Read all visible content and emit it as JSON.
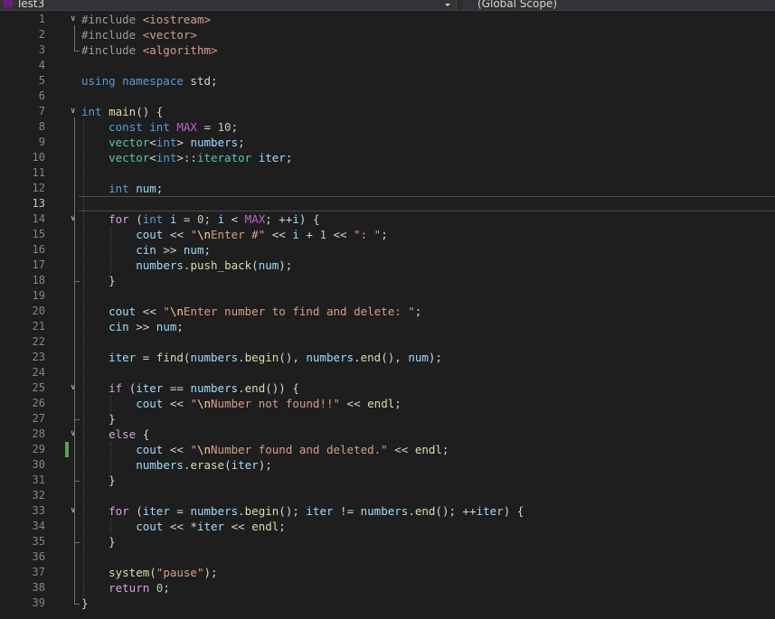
{
  "topbar": {
    "file_dropdown_label": "Test3",
    "scope_dropdown_label": "(Global Scope)"
  },
  "colors": {
    "keyword": "#569cd6",
    "control": "#d8a0df",
    "type": "#4ec9b0",
    "string": "#d69d85",
    "escape": "#ffd68f",
    "number": "#b5cea8",
    "variable": "#9cdcfe",
    "function": "#dcdcaa",
    "preprocessor": "#9b9b9b",
    "text": "#d4d4d4",
    "macro": "#bd63c5"
  },
  "editor": {
    "current_line": 13,
    "changed_lines": [
      29
    ],
    "fold_lines": [
      1,
      7,
      14,
      25,
      28,
      33
    ],
    "lines": [
      {
        "n": "1",
        "tokens": [
          [
            "#include ",
            "preprocessor"
          ],
          [
            "<iostream>",
            "string"
          ]
        ]
      },
      {
        "n": "2",
        "tokens": [
          [
            "#include ",
            "preprocessor"
          ],
          [
            "<vector>",
            "string"
          ]
        ]
      },
      {
        "n": "3",
        "tokens": [
          [
            "#include ",
            "preprocessor"
          ],
          [
            "<algorithm>",
            "string"
          ]
        ]
      },
      {
        "n": "4",
        "tokens": []
      },
      {
        "n": "5",
        "tokens": [
          [
            "using ",
            "keyword"
          ],
          [
            "namespace ",
            "keyword"
          ],
          [
            "std;",
            "text"
          ]
        ]
      },
      {
        "n": "6",
        "tokens": []
      },
      {
        "n": "7",
        "tokens": [
          [
            "int ",
            "keyword"
          ],
          [
            "main",
            "function"
          ],
          [
            "() {",
            "text"
          ]
        ]
      },
      {
        "n": "8",
        "tokens": [
          [
            "    ",
            "text"
          ],
          [
            "const ",
            "keyword"
          ],
          [
            "int ",
            "keyword"
          ],
          [
            "MAX",
            "macro"
          ],
          [
            " = ",
            "text"
          ],
          [
            "10",
            "number"
          ],
          [
            ";",
            "text"
          ]
        ]
      },
      {
        "n": "9",
        "tokens": [
          [
            "    ",
            "text"
          ],
          [
            "vector",
            "type"
          ],
          [
            "<",
            "text"
          ],
          [
            "int",
            "keyword"
          ],
          [
            "> ",
            "text"
          ],
          [
            "numbers",
            "variable"
          ],
          [
            ";",
            "text"
          ]
        ]
      },
      {
        "n": "10",
        "tokens": [
          [
            "    ",
            "text"
          ],
          [
            "vector",
            "type"
          ],
          [
            "<",
            "text"
          ],
          [
            "int",
            "keyword"
          ],
          [
            ">::",
            "text"
          ],
          [
            "iterator",
            "type"
          ],
          [
            " ",
            "text"
          ],
          [
            "iter",
            "variable"
          ],
          [
            ";",
            "text"
          ]
        ]
      },
      {
        "n": "11",
        "tokens": []
      },
      {
        "n": "12",
        "tokens": [
          [
            "    ",
            "text"
          ],
          [
            "int ",
            "keyword"
          ],
          [
            "num",
            "variable"
          ],
          [
            ";",
            "text"
          ]
        ]
      },
      {
        "n": "13",
        "tokens": []
      },
      {
        "n": "14",
        "tokens": [
          [
            "    ",
            "text"
          ],
          [
            "for ",
            "control"
          ],
          [
            "(",
            "text"
          ],
          [
            "int ",
            "keyword"
          ],
          [
            "i",
            "variable"
          ],
          [
            " = ",
            "text"
          ],
          [
            "0",
            "number"
          ],
          [
            "; ",
            "text"
          ],
          [
            "i",
            "variable"
          ],
          [
            " < ",
            "text"
          ],
          [
            "MAX",
            "macro"
          ],
          [
            "; ++",
            "text"
          ],
          [
            "i",
            "variable"
          ],
          [
            ") {",
            "text"
          ]
        ]
      },
      {
        "n": "15",
        "tokens": [
          [
            "        ",
            "text"
          ],
          [
            "cout",
            "variable"
          ],
          [
            " << ",
            "text"
          ],
          [
            "\"",
            "string"
          ],
          [
            "\\n",
            "escape"
          ],
          [
            "Enter #\"",
            "string"
          ],
          [
            " << ",
            "text"
          ],
          [
            "i",
            "variable"
          ],
          [
            " + ",
            "text"
          ],
          [
            "1",
            "number"
          ],
          [
            " << ",
            "text"
          ],
          [
            "\": \"",
            "string"
          ],
          [
            ";",
            "text"
          ]
        ]
      },
      {
        "n": "16",
        "tokens": [
          [
            "        ",
            "text"
          ],
          [
            "cin",
            "variable"
          ],
          [
            " >> ",
            "text"
          ],
          [
            "num",
            "variable"
          ],
          [
            ";",
            "text"
          ]
        ]
      },
      {
        "n": "17",
        "tokens": [
          [
            "        ",
            "text"
          ],
          [
            "numbers",
            "variable"
          ],
          [
            ".",
            "text"
          ],
          [
            "push_back",
            "function"
          ],
          [
            "(",
            "text"
          ],
          [
            "num",
            "variable"
          ],
          [
            ");",
            "text"
          ]
        ]
      },
      {
        "n": "18",
        "tokens": [
          [
            "    }",
            "text"
          ]
        ]
      },
      {
        "n": "19",
        "tokens": []
      },
      {
        "n": "20",
        "tokens": [
          [
            "    ",
            "text"
          ],
          [
            "cout",
            "variable"
          ],
          [
            " << ",
            "text"
          ],
          [
            "\"",
            "string"
          ],
          [
            "\\n",
            "escape"
          ],
          [
            "Enter number to find and delete: \"",
            "string"
          ],
          [
            ";",
            "text"
          ]
        ]
      },
      {
        "n": "21",
        "tokens": [
          [
            "    ",
            "text"
          ],
          [
            "cin",
            "variable"
          ],
          [
            " >> ",
            "text"
          ],
          [
            "num",
            "variable"
          ],
          [
            ";",
            "text"
          ]
        ]
      },
      {
        "n": "22",
        "tokens": []
      },
      {
        "n": "23",
        "tokens": [
          [
            "    ",
            "text"
          ],
          [
            "iter",
            "variable"
          ],
          [
            " = ",
            "text"
          ],
          [
            "find",
            "function"
          ],
          [
            "(",
            "text"
          ],
          [
            "numbers",
            "variable"
          ],
          [
            ".",
            "text"
          ],
          [
            "begin",
            "function"
          ],
          [
            "(), ",
            "text"
          ],
          [
            "numbers",
            "variable"
          ],
          [
            ".",
            "text"
          ],
          [
            "end",
            "function"
          ],
          [
            "(), ",
            "text"
          ],
          [
            "num",
            "variable"
          ],
          [
            ");",
            "text"
          ]
        ]
      },
      {
        "n": "24",
        "tokens": []
      },
      {
        "n": "25",
        "tokens": [
          [
            "    ",
            "text"
          ],
          [
            "if ",
            "control"
          ],
          [
            "(",
            "text"
          ],
          [
            "iter",
            "variable"
          ],
          [
            " == ",
            "text"
          ],
          [
            "numbers",
            "variable"
          ],
          [
            ".",
            "text"
          ],
          [
            "end",
            "function"
          ],
          [
            "()) {",
            "text"
          ]
        ]
      },
      {
        "n": "26",
        "tokens": [
          [
            "        ",
            "text"
          ],
          [
            "cout",
            "variable"
          ],
          [
            " << ",
            "text"
          ],
          [
            "\"",
            "string"
          ],
          [
            "\\n",
            "escape"
          ],
          [
            "Number not found!!\"",
            "string"
          ],
          [
            " << ",
            "text"
          ],
          [
            "endl",
            "function"
          ],
          [
            ";",
            "text"
          ]
        ]
      },
      {
        "n": "27",
        "tokens": [
          [
            "    }",
            "text"
          ]
        ]
      },
      {
        "n": "28",
        "tokens": [
          [
            "    ",
            "text"
          ],
          [
            "else ",
            "control"
          ],
          [
            "{",
            "text"
          ]
        ]
      },
      {
        "n": "29",
        "tokens": [
          [
            "        ",
            "text"
          ],
          [
            "cout",
            "variable"
          ],
          [
            " << ",
            "text"
          ],
          [
            "\"",
            "string"
          ],
          [
            "\\n",
            "escape"
          ],
          [
            "Number found and deleted.\"",
            "string"
          ],
          [
            " << ",
            "text"
          ],
          [
            "endl",
            "function"
          ],
          [
            ";",
            "text"
          ]
        ]
      },
      {
        "n": "30",
        "tokens": [
          [
            "        ",
            "text"
          ],
          [
            "numbers",
            "variable"
          ],
          [
            ".",
            "text"
          ],
          [
            "erase",
            "function"
          ],
          [
            "(",
            "text"
          ],
          [
            "iter",
            "variable"
          ],
          [
            ");",
            "text"
          ]
        ]
      },
      {
        "n": "31",
        "tokens": [
          [
            "    }",
            "text"
          ]
        ]
      },
      {
        "n": "32",
        "tokens": []
      },
      {
        "n": "33",
        "tokens": [
          [
            "    ",
            "text"
          ],
          [
            "for ",
            "control"
          ],
          [
            "(",
            "text"
          ],
          [
            "iter",
            "variable"
          ],
          [
            " = ",
            "text"
          ],
          [
            "numbers",
            "variable"
          ],
          [
            ".",
            "text"
          ],
          [
            "begin",
            "function"
          ],
          [
            "(); ",
            "text"
          ],
          [
            "iter",
            "variable"
          ],
          [
            " != ",
            "text"
          ],
          [
            "numbers",
            "variable"
          ],
          [
            ".",
            "text"
          ],
          [
            "end",
            "function"
          ],
          [
            "(); ++",
            "text"
          ],
          [
            "iter",
            "variable"
          ],
          [
            ") {",
            "text"
          ]
        ]
      },
      {
        "n": "34",
        "tokens": [
          [
            "        ",
            "text"
          ],
          [
            "cout",
            "variable"
          ],
          [
            " << *",
            "text"
          ],
          [
            "iter",
            "variable"
          ],
          [
            " << ",
            "text"
          ],
          [
            "endl",
            "function"
          ],
          [
            ";",
            "text"
          ]
        ]
      },
      {
        "n": "35",
        "tokens": [
          [
            "    }",
            "text"
          ]
        ]
      },
      {
        "n": "36",
        "tokens": []
      },
      {
        "n": "37",
        "tokens": [
          [
            "    ",
            "text"
          ],
          [
            "system",
            "function"
          ],
          [
            "(",
            "text"
          ],
          [
            "\"pause\"",
            "string"
          ],
          [
            ");",
            "text"
          ]
        ]
      },
      {
        "n": "38",
        "tokens": [
          [
            "    ",
            "text"
          ],
          [
            "return ",
            "control"
          ],
          [
            "0",
            "number"
          ],
          [
            ";",
            "text"
          ]
        ]
      },
      {
        "n": "39",
        "tokens": [
          [
            "}",
            "text"
          ]
        ]
      }
    ]
  }
}
